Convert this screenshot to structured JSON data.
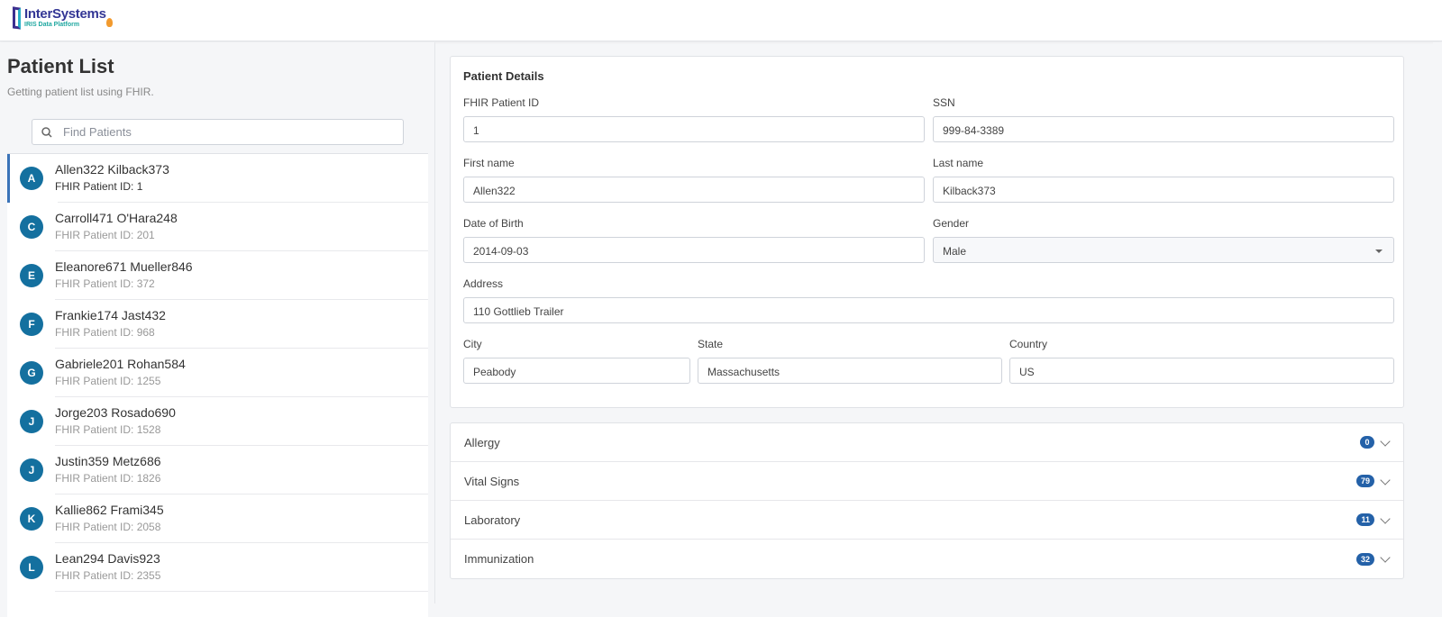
{
  "header": {
    "logo_title": "InterSystems",
    "logo_subtitle": "IRIS Data Platform"
  },
  "left": {
    "title": "Patient List",
    "subtitle": "Getting patient list using FHIR.",
    "search_placeholder": "Find Patients",
    "patients": [
      {
        "initial": "A",
        "name": "Allen322 Kilback373",
        "id": "FHIR Patient ID: 1"
      },
      {
        "initial": "C",
        "name": "Carroll471 O'Hara248",
        "id": "FHIR Patient ID: 201"
      },
      {
        "initial": "E",
        "name": "Eleanore671 Mueller846",
        "id": "FHIR Patient ID: 372"
      },
      {
        "initial": "F",
        "name": "Frankie174 Jast432",
        "id": "FHIR Patient ID: 968"
      },
      {
        "initial": "G",
        "name": "Gabriele201 Rohan584",
        "id": "FHIR Patient ID: 1255"
      },
      {
        "initial": "J",
        "name": "Jorge203 Rosado690",
        "id": "FHIR Patient ID: 1528"
      },
      {
        "initial": "J",
        "name": "Justin359 Metz686",
        "id": "FHIR Patient ID: 1826"
      },
      {
        "initial": "K",
        "name": "Kallie862 Frami345",
        "id": "FHIR Patient ID: 2058"
      },
      {
        "initial": "L",
        "name": "Lean294 Davis923",
        "id": "FHIR Patient ID: 2355"
      }
    ]
  },
  "details": {
    "title": "Patient Details",
    "fhir_id": {
      "label": "FHIR Patient ID",
      "value": "1"
    },
    "ssn": {
      "label": "SSN",
      "value": "999-84-3389"
    },
    "first": {
      "label": "First name",
      "value": "Allen322"
    },
    "last": {
      "label": "Last name",
      "value": "Kilback373"
    },
    "dob": {
      "label": "Date of Birth",
      "value": "2014-09-03"
    },
    "gender": {
      "label": "Gender",
      "value": "Male"
    },
    "address": {
      "label": "Address",
      "value": "110 Gottlieb Trailer"
    },
    "city": {
      "label": "City",
      "value": "Peabody"
    },
    "state": {
      "label": "State",
      "value": "Massachusetts"
    },
    "country": {
      "label": "Country",
      "value": "US"
    }
  },
  "sections": [
    {
      "label": "Allergy",
      "count": "0"
    },
    {
      "label": "Vital Signs",
      "count": "79"
    },
    {
      "label": "Laboratory",
      "count": "11"
    },
    {
      "label": "Immunization",
      "count": "32"
    }
  ]
}
